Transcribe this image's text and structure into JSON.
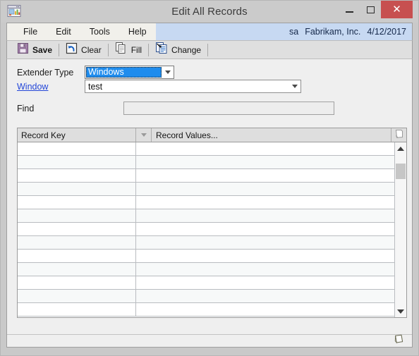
{
  "window": {
    "title": "Edit All Records",
    "icon": "gp-window-chart-icon",
    "controls": {
      "minimize": "minimize-icon",
      "maximize": "maximize-icon",
      "close": "close-icon"
    }
  },
  "menubar": {
    "items": [
      {
        "label": "File"
      },
      {
        "label": "Edit"
      },
      {
        "label": "Tools"
      },
      {
        "label": "Help"
      }
    ],
    "user": "sa",
    "company": "Fabrikam, Inc.",
    "date": "4/12/2017"
  },
  "toolbar": {
    "buttons": [
      {
        "label": "Save",
        "icon": "floppy-disk-icon",
        "bold": true
      },
      {
        "label": "Clear",
        "icon": "undo-arrow-icon",
        "bold": false
      },
      {
        "label": "Fill",
        "icon": "copy-pages-icon",
        "bold": false
      },
      {
        "label": "Change",
        "icon": "document-change-icon",
        "bold": false
      }
    ]
  },
  "form": {
    "extender_type": {
      "label": "Extender Type",
      "value": "Windows",
      "focused": true
    },
    "window": {
      "label": "Window",
      "value": "test",
      "is_link": true
    },
    "find": {
      "label": "Find",
      "value": "",
      "placeholder": ""
    }
  },
  "grid": {
    "columns": [
      {
        "label": "Record Key"
      },
      {
        "label": "Record Values..."
      }
    ],
    "sort_icon": "chevron-down-icon",
    "note_icon": "note-icon",
    "rows": [
      {
        "key": "",
        "values": ""
      },
      {
        "key": "",
        "values": ""
      },
      {
        "key": "",
        "values": ""
      },
      {
        "key": "",
        "values": ""
      },
      {
        "key": "",
        "values": ""
      },
      {
        "key": "",
        "values": ""
      },
      {
        "key": "",
        "values": ""
      },
      {
        "key": "",
        "values": ""
      },
      {
        "key": "",
        "values": ""
      },
      {
        "key": "",
        "values": ""
      },
      {
        "key": "",
        "values": ""
      },
      {
        "key": "",
        "values": ""
      },
      {
        "key": "",
        "values": ""
      }
    ],
    "scrollbar": {
      "up_icon": "scroll-up-icon",
      "down_icon": "scroll-down-icon"
    }
  },
  "statusbar": {
    "note_icon": "note-icon"
  },
  "colors": {
    "accent_blue": "#1f8ced",
    "link_blue": "#2346d8",
    "menu_band": "#c7d9f2",
    "close_red": "#c75050",
    "frame_gray": "#c9c9c9",
    "form_bg": "#efefef"
  }
}
